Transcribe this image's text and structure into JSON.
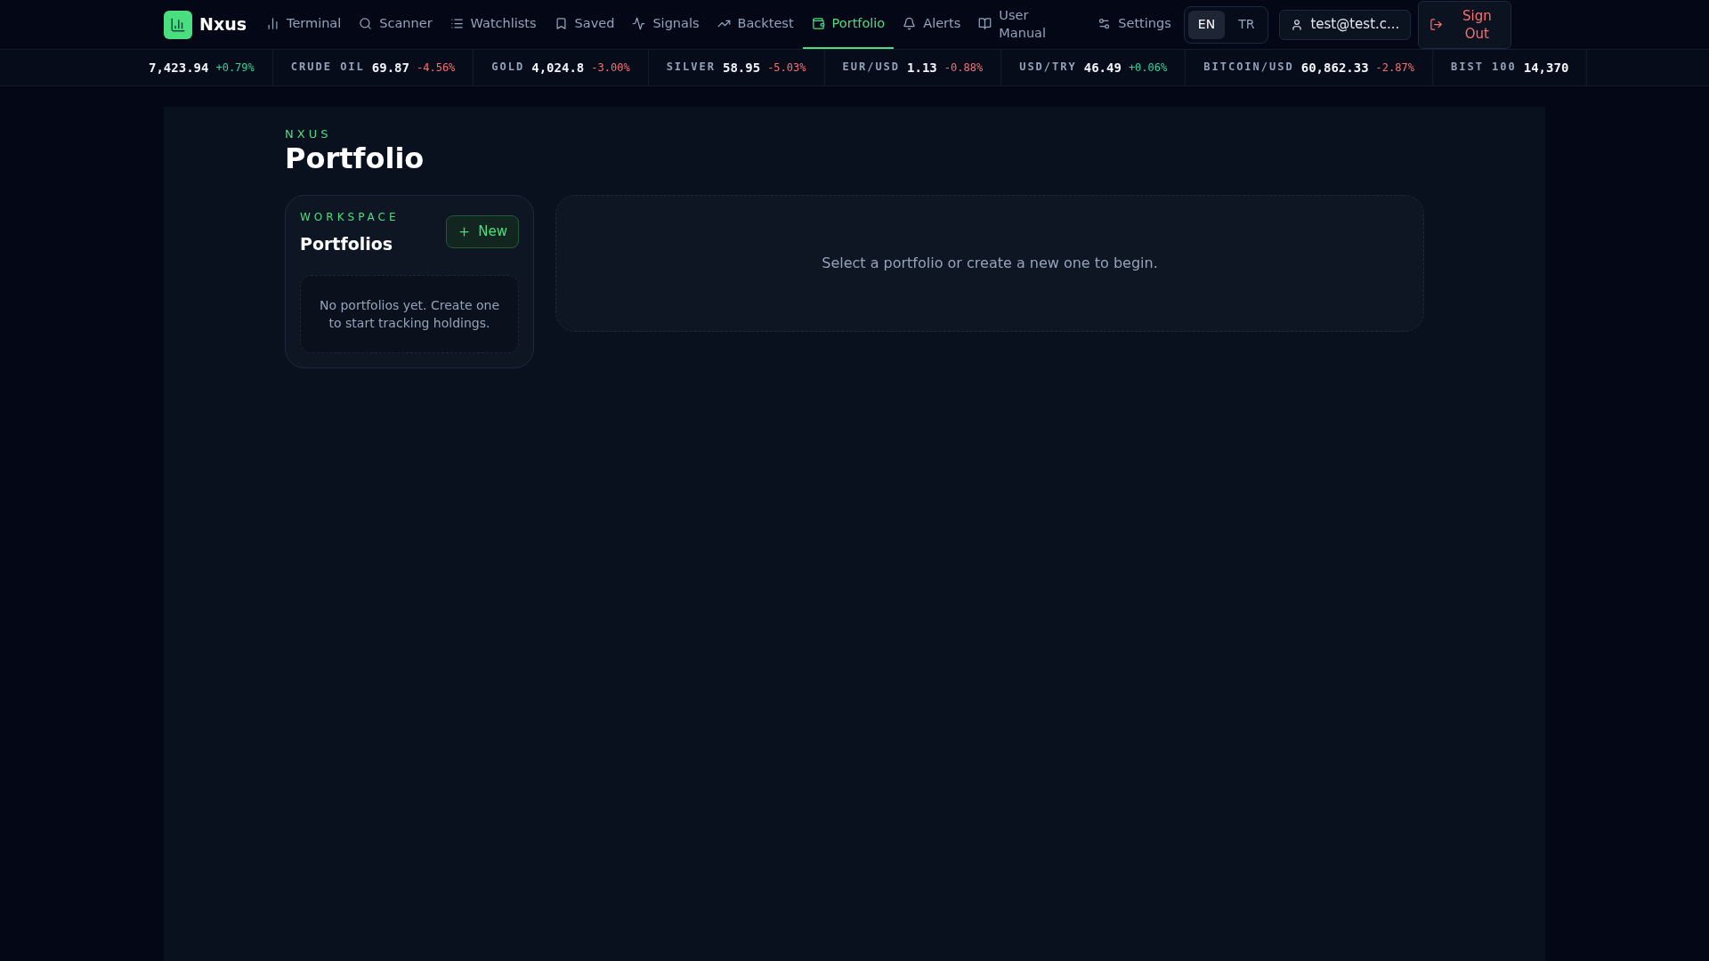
{
  "brand": {
    "name": "Nxus"
  },
  "nav": [
    {
      "label": "Terminal",
      "selected": false
    },
    {
      "label": "Scanner",
      "selected": false
    },
    {
      "label": "Watchlists",
      "selected": false
    },
    {
      "label": "Saved",
      "selected": false
    },
    {
      "label": "Signals",
      "selected": false
    },
    {
      "label": "Backtest",
      "selected": false
    },
    {
      "label": "Portfolio",
      "selected": true
    },
    {
      "label": "Alerts",
      "selected": false
    },
    {
      "label": "User Manual",
      "selected": false
    },
    {
      "label": "Settings",
      "selected": false
    }
  ],
  "languages": [
    {
      "label": "EN",
      "selected": true
    },
    {
      "label": "TR",
      "selected": false
    }
  ],
  "user": {
    "email": "test@test.c..."
  },
  "sign_out": {
    "label": "Sign Out"
  },
  "ticker": [
    {
      "value": "7,423.94",
      "change": "+0.79%",
      "color": "#34d399"
    },
    {
      "label": "CRUDE OIL",
      "value": "69.87",
      "change": "-4.56%",
      "color": "#f87171"
    },
    {
      "label": "GOLD",
      "value": "4,024.8",
      "change": "-3.00%",
      "color": "#f87171"
    },
    {
      "label": "SILVER",
      "value": "58.95",
      "change": "-5.03%",
      "color": "#f87171"
    },
    {
      "label": "EUR/USD",
      "value": "1.13",
      "change": "-0.88%",
      "color": "#f87171"
    },
    {
      "label": "USD/TRY",
      "value": "46.49",
      "change": "+0.06%",
      "color": "#34d399"
    },
    {
      "label": "BITCOIN/USD",
      "value": "60,862.33",
      "change": "-2.87%",
      "color": "#f87171"
    },
    {
      "label": "BIST 100",
      "value": "14,370"
    }
  ],
  "page": {
    "eyebrow": "NXUS",
    "title": "Portfolio"
  },
  "sidebar": {
    "eyebrow": "WORKSPACE",
    "title": "Portfolios",
    "new_button": "New",
    "empty_text": "No portfolios yet. Create one to start tracking holdings."
  },
  "main": {
    "empty_text": "Select a portfolio or create a new one to begin."
  }
}
